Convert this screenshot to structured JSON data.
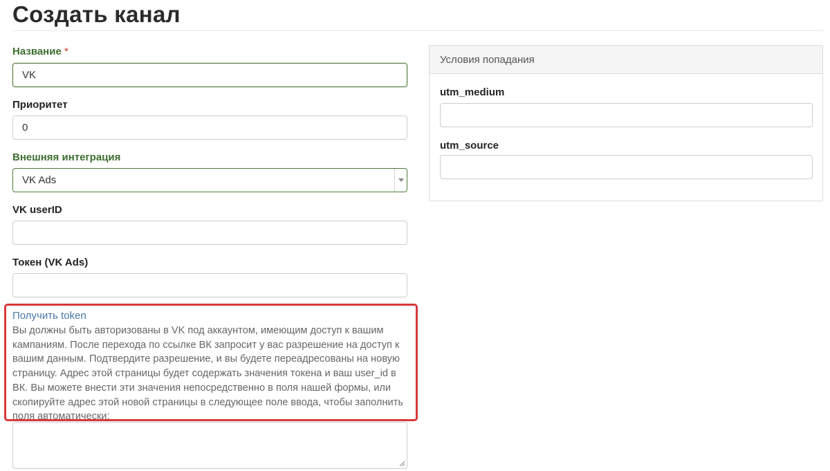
{
  "page": {
    "title": "Создать канал"
  },
  "form": {
    "name": {
      "label": "Название",
      "required_mark": "*",
      "value": "VK"
    },
    "priority": {
      "label": "Приоритет",
      "value": "0"
    },
    "integration": {
      "label": "Внешняя интеграция",
      "selected": "VK Ads"
    },
    "vk_user_id": {
      "label": "VK userID",
      "value": ""
    },
    "token": {
      "label": "Токен (VK Ads)",
      "value": ""
    },
    "help": {
      "link_text": "Получить token",
      "text": "Вы должны быть авторизованы в VK под аккаунтом, имеющим доступ к вашим кампаниям. После перехода по ссылке ВК запросит у вас разрешение на доступ к вашим данным. Подтвердите разрешение, и вы будете переадресованы на новую страницу. Адрес этой страницы будет содержать значения токена и ваш user_id в ВК. Вы можете внести эти значения непосредственно в поля нашей формы, или скопируйте адрес этой новой страницы в следующее поле ввода, чтобы заполнить поля автоматически:",
      "highlight_color": "#d9373a"
    },
    "url_input": {
      "value": ""
    }
  },
  "conditions": {
    "header": "Условия попадания",
    "utm_medium": {
      "label": "utm_medium",
      "value": ""
    },
    "utm_source": {
      "label": "utm_source",
      "value": ""
    }
  },
  "colors": {
    "accent_green": "#4f7a3a",
    "label_green": "#3c6e2f",
    "link_blue": "#4a78a8",
    "highlight_red": "#d9373a"
  }
}
